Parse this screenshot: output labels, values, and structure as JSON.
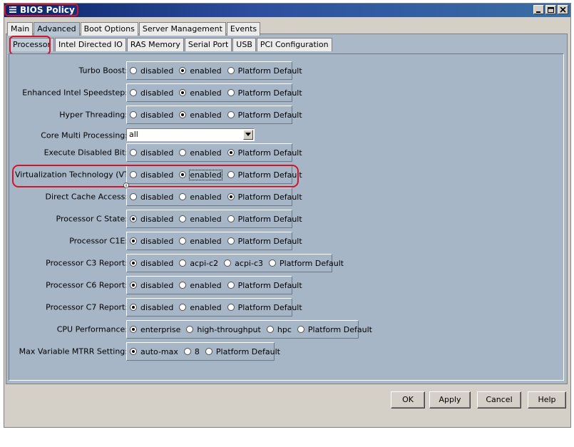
{
  "window": {
    "title": "BIOS Policy"
  },
  "tabs": [
    "Main",
    "Advanced",
    "Boot Options",
    "Server Management",
    "Events"
  ],
  "active_tab": "Advanced",
  "subtabs": [
    "Processor",
    "Intel Directed IO",
    "RAS Memory",
    "Serial Port",
    "USB",
    "PCI Configuration"
  ],
  "active_subtab": "Processor",
  "settings": [
    {
      "label": "Turbo Boost:",
      "options": [
        "disabled",
        "enabled",
        "Platform Default"
      ],
      "selected": "enabled"
    },
    {
      "label": "Enhanced Intel Speedstep:",
      "options": [
        "disabled",
        "enabled",
        "Platform Default"
      ],
      "selected": "enabled"
    },
    {
      "label": "Hyper Threading:",
      "options": [
        "disabled",
        "enabled",
        "Platform Default"
      ],
      "selected": "enabled"
    },
    {
      "label": "Core Multi Processing:",
      "dropdown_value": "all"
    },
    {
      "label": "Execute Disabled Bit:",
      "options": [
        "disabled",
        "enabled",
        "Platform Default"
      ],
      "selected": "Platform Default"
    },
    {
      "label": "Virtualization Technology (VT):",
      "options": [
        "disabled",
        "enabled",
        "Platform Default"
      ],
      "selected": "enabled"
    },
    {
      "label": "Direct Cache Access:",
      "options": [
        "disabled",
        "enabled",
        "Platform Default"
      ],
      "selected": "Platform Default"
    },
    {
      "label": "Processor C State:",
      "options": [
        "disabled",
        "enabled",
        "Platform Default"
      ],
      "selected": "disabled"
    },
    {
      "label": "Processor C1E:",
      "options": [
        "disabled",
        "enabled",
        "Platform Default"
      ],
      "selected": "disabled"
    },
    {
      "label": "Processor C3 Report:",
      "options": [
        "disabled",
        "acpi-c2",
        "acpi-c3",
        "Platform Default"
      ],
      "selected": "disabled"
    },
    {
      "label": "Processor C6 Report:",
      "options": [
        "disabled",
        "enabled",
        "Platform Default"
      ],
      "selected": "disabled"
    },
    {
      "label": "Processor C7 Report:",
      "options": [
        "disabled",
        "enabled",
        "Platform Default"
      ],
      "selected": "disabled"
    },
    {
      "label": "CPU Performance:",
      "options": [
        "enterprise",
        "high-throughput",
        "hpc",
        "Platform Default"
      ],
      "selected": "enterprise"
    },
    {
      "label": "Max Variable MTRR Setting:",
      "options": [
        "auto-max",
        "8",
        "Platform Default"
      ],
      "selected": "auto-max"
    }
  ],
  "buttons": {
    "ok": "OK",
    "apply": "Apply",
    "cancel": "Cancel",
    "help": "Help"
  },
  "colors": {
    "highlight": "#d0142c",
    "panel": "#a7b6c6"
  }
}
